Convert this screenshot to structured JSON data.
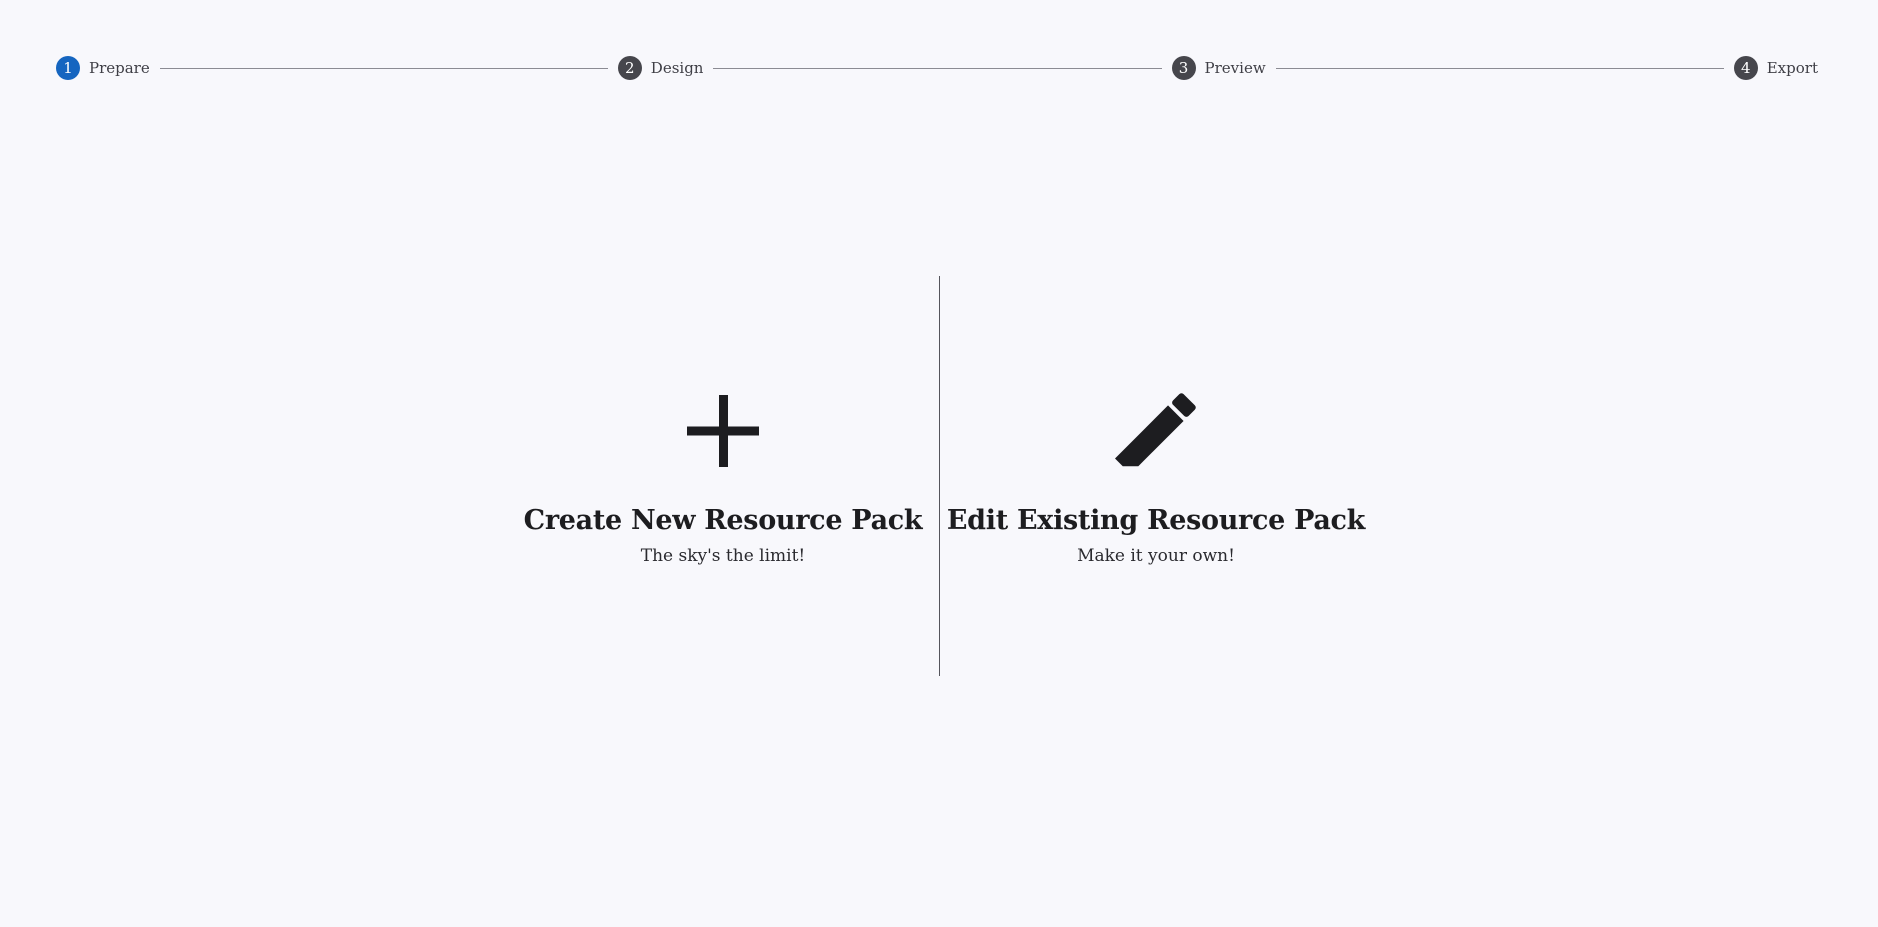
{
  "stepper": {
    "steps": [
      {
        "number": "1",
        "label": "Prepare",
        "active": true
      },
      {
        "number": "2",
        "label": "Design",
        "active": false
      },
      {
        "number": "3",
        "label": "Preview",
        "active": false
      },
      {
        "number": "4",
        "label": "Export",
        "active": false
      }
    ]
  },
  "options": {
    "create": {
      "icon": "plus-icon",
      "title": "Create New Resource Pack",
      "subtitle": "The sky's the limit!"
    },
    "edit": {
      "icon": "pencil-icon",
      "title": "Edit Existing Resource Pack",
      "subtitle": "Make it your own!"
    }
  },
  "colors": {
    "background": "#f8f8fc",
    "active_step": "#1565c0",
    "inactive_step": "#46464c",
    "text": "#1d1d20"
  }
}
